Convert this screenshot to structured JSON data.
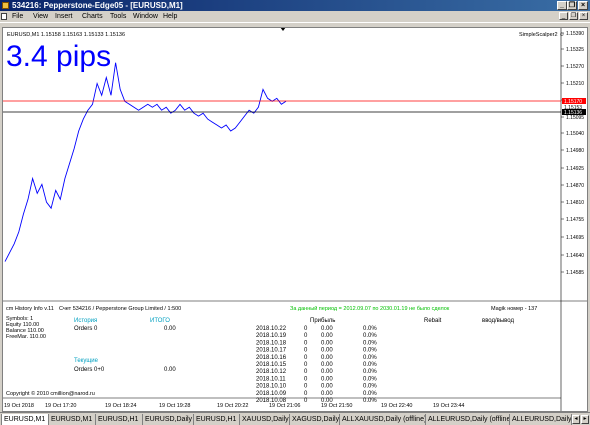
{
  "window": {
    "title": "534216: Pepperstone-Edge05 - [EURUSD,M1]",
    "minimize": "_",
    "restore": "❐",
    "close": "×"
  },
  "menu": [
    "File",
    "View",
    "Insert",
    "Charts",
    "Tools",
    "Window",
    "Help"
  ],
  "colors": {
    "price_line": "#0000ff",
    "pips_text": "#0000ff",
    "red_level": "#ff0000",
    "black_level": "#000000",
    "green_text": "#00c000",
    "cyan_text": "#00a0c0"
  },
  "chart": {
    "symbol_header": "EURUSD,M1  1.15158  1.15163  1.15133  1.15136",
    "pips_label": "3.4 pips",
    "ea_name": "SimpleScalper2 ☺",
    "y_ticks": [
      "1.15390",
      "1.15325",
      "1.15270",
      "1.15210",
      "1.15150",
      "1.15095",
      "1.15040",
      "1.14980",
      "1.14925",
      "1.14870",
      "1.14810",
      "1.14755",
      "1.14695",
      "1.14640",
      "1.14585"
    ],
    "red_level_label": "1.15170",
    "black_level_label": "1.15136",
    "bid_label": "1.15153",
    "x_ticks": [
      "19 Oct 2018",
      "19 Oct 17:20",
      "19 Oct 18:24",
      "19 Oct 19:28",
      "19 Oct 20:22",
      "19 Oct 21:06",
      "19 Oct 21:50",
      "19 Oct 22:40",
      "19 Oct 23:44"
    ]
  },
  "chart_data": {
    "type": "line",
    "series": [
      {
        "values": [
          1.1462,
          1.1465,
          1.1468,
          1.1472,
          1.1478,
          1.1483,
          1.149,
          1.1485,
          1.1488,
          1.1482,
          1.148,
          1.1486,
          1.1483,
          1.149,
          1.1495,
          1.15,
          1.1506,
          1.151,
          1.1513,
          1.1515,
          1.1522,
          1.1518,
          1.1524,
          1.1518,
          1.1529,
          1.152,
          1.1516,
          1.1515,
          1.1514,
          1.1513,
          1.1514,
          1.1515,
          1.1514,
          1.1515,
          1.1513,
          1.1514,
          1.1512,
          1.1513,
          1.1515,
          1.1513,
          1.1514,
          1.1512,
          1.1511,
          1.1512,
          1.151,
          1.1509,
          1.1508,
          1.1507,
          1.1508,
          1.1506,
          1.1507,
          1.1509,
          1.1511,
          1.1513,
          1.1512,
          1.1514,
          1.152,
          1.1517,
          1.1516,
          1.1517,
          1.1515,
          1.1516
        ]
      }
    ],
    "ylim": [
      1.14585,
      1.1539
    ]
  },
  "panel": {
    "caption_left": "cm History Info v.11",
    "caption_mid": "Счет 534216 / Pepperstone Group Limited / 1:500",
    "caption_green": "За данный период = 2012.09.07 по 2030.01.19 не было сделок",
    "caption_right": "Magik номер - 137",
    "symbols_line": "Symbols: 1",
    "equity_line": "Equity    110.00",
    "balance_line": "Balance   110.00",
    "freemar_line": "FreeMar.  110.00",
    "history_label": "История",
    "orders_label": "Orders 0",
    "itogo_label": "ИТОГО",
    "itogo_value": "0.00",
    "current_label": "Текущие",
    "orders_current": "Orders 0+0",
    "current_value": "0.00",
    "profit_header": "Прибыль",
    "rebait_header": "Rebait",
    "vvod_header": "ввод/вывод",
    "copyright": "Copyright © 2010 cmillion@narod.ru",
    "rows": [
      {
        "date": "2018.10.22",
        "n": "0",
        "profit": "0.00",
        "pct": "0.0%"
      },
      {
        "date": "2018.10.19",
        "n": "0",
        "profit": "0.00",
        "pct": "0.0%"
      },
      {
        "date": "2018.10.18",
        "n": "0",
        "profit": "0.00",
        "pct": "0.0%"
      },
      {
        "date": "2018.10.17",
        "n": "0",
        "profit": "0.00",
        "pct": "0.0%"
      },
      {
        "date": "2018.10.16",
        "n": "0",
        "profit": "0.00",
        "pct": "0.0%"
      },
      {
        "date": "2018.10.15",
        "n": "0",
        "profit": "0.00",
        "pct": "0.0%"
      },
      {
        "date": "2018.10.12",
        "n": "0",
        "profit": "0.00",
        "pct": "0.0%"
      },
      {
        "date": "2018.10.11",
        "n": "0",
        "profit": "0.00",
        "pct": "0.0%"
      },
      {
        "date": "2018.10.10",
        "n": "0",
        "profit": "0.00",
        "pct": "0.0%"
      },
      {
        "date": "2018.10.09",
        "n": "0",
        "profit": "0.00",
        "pct": "0.0%"
      },
      {
        "date": "2018.10.08",
        "n": "0",
        "profit": "0.00",
        "pct": "0.0%"
      }
    ]
  },
  "tabs": [
    "EURUSD,M1",
    "EURUSD,M1",
    "EURUSD,H1",
    "EURUSD,Daily",
    "EURUSD,H1",
    "XAUUSD,Daily",
    "XAGUSD,Daily",
    "ALLXAUUSD,Daily (offline)",
    "ALLEURUSD,Daily (offline)",
    "ALLEURUSD,Daily"
  ]
}
